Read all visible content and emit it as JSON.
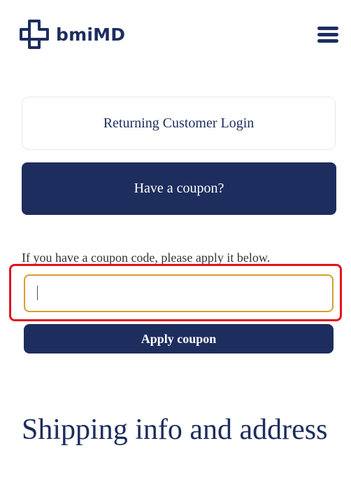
{
  "header": {
    "logo_text": "bmiMD",
    "menu_icon": "hamburger-menu-icon",
    "logo_icon": "medical-cross-outline-icon"
  },
  "login": {
    "label": "Returning Customer Login"
  },
  "coupon": {
    "toggle_label": "Have a coupon?",
    "note": "If you have a coupon code, please apply it below.",
    "input_value": "",
    "input_placeholder": "",
    "apply_label": "Apply coupon"
  },
  "shipping": {
    "title": "Shipping info and address"
  },
  "colors": {
    "brand": "#1d2d5e",
    "input_focus_border": "#d79e30",
    "highlight": "#e3131d"
  }
}
